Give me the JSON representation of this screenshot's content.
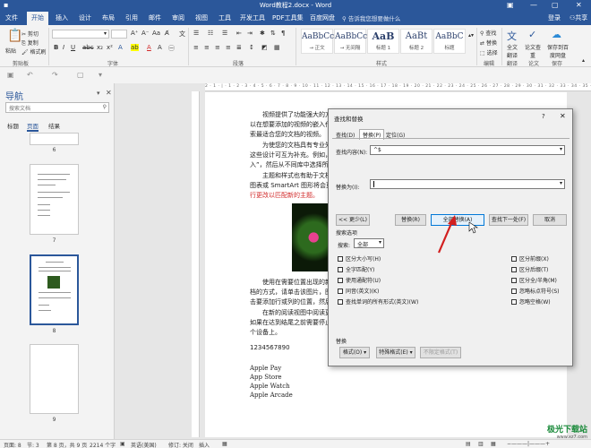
{
  "window": {
    "title": "Word教程2.docx - Word"
  },
  "tabs": [
    "文件",
    "开始",
    "插入",
    "设计",
    "布局",
    "引用",
    "邮件",
    "审阅",
    "视图",
    "工具",
    "开发工具",
    "PDF工具集",
    "百度网盘"
  ],
  "active_tab": "开始",
  "tell_me": "告诉我您想要做什么",
  "account": {
    "login": "登录",
    "share": "共享"
  },
  "ribbon": {
    "clipboard": {
      "paste": "粘贴",
      "cut": "剪切",
      "copy": "复制",
      "format_painter": "格式刷",
      "label": "剪贴板"
    },
    "font": {
      "label": "字体"
    },
    "paragraph": {
      "label": "段落"
    },
    "styles": {
      "label": "样式",
      "items": [
        {
          "preview": "AaBbCc",
          "name": "→ 正文"
        },
        {
          "preview": "AaBbCc",
          "name": "→ 无间隔"
        },
        {
          "preview": "AaB",
          "name": "标题 1"
        },
        {
          "preview": "AaBt",
          "name": "标题 2"
        },
        {
          "preview": "AaBbC",
          "name": "标题"
        }
      ]
    },
    "editing": {
      "find": "查找",
      "replace": "替换",
      "select": "选择",
      "label": "编辑"
    },
    "translate": {
      "full": "全文翻译",
      "label": "翻译"
    },
    "paper": {
      "check": "论文查重",
      "label": "论文"
    },
    "save": {
      "label": "保存到百度网盘",
      "group": "保存"
    }
  },
  "navigation": {
    "title": "导航",
    "search_placeholder": "搜索文档",
    "tabs": [
      "标题",
      "页面",
      "结果"
    ],
    "active_tab": "页面",
    "pages": [
      "6",
      "7",
      "8",
      "9"
    ],
    "selected_page": "8"
  },
  "ruler": "2 · 1 · | · 1 · 2 · 3 · 4 · 5 · 6 · 7 · 8 · 9 · 10 · 11 · 12 · 13 · 14 · 15 · 16 · 17 · 18 · 19 · 20 · 21 · 22 · 23 · 24 · 25 · 26 · 27 · 28 · 29 · 30 · 31 · 32 · 33 · 34 · 35 · 36 · 37",
  "document": {
    "para1": [
      "　　视频提供了功能强大的方",
      "以在想要添加的视频的嵌入代",
      "索最适合您的文档的视频。"
    ],
    "para2": [
      "　　为使您的文档具有专业外",
      "这些设计可互为补充。例如，",
      "入”，然后从不同库中选择所"
    ],
    "para3": [
      "　　主题和样式也有助于文档",
      "图表或 SmartArt 图形将会更"
    ],
    "para3_red": "行更改以匹配新的主题。",
    "para4": [
      "　　使用在需要位置出现的新",
      "档的方式，请单击该图片，图",
      "击要添加行或列的位置，然后"
    ],
    "para5": [
      "　　在新的阅读视图中阅读更",
      "如果在达到结尾之前需要停止",
      "个设备上。"
    ],
    "number": "1234567890",
    "list": [
      "Apple Pay",
      "App Store",
      "Apple Watch",
      "Apple Arcade"
    ]
  },
  "dialog": {
    "title": "查找和替换",
    "help": "?",
    "close": "✕",
    "tabs": [
      "查找(D)",
      "替换(P)",
      "定位(G)"
    ],
    "active_tab": "替换(P)",
    "find_label": "查找内容(N):",
    "find_value": "^$",
    "replace_label": "替换为(I):",
    "replace_value": "",
    "buttons": {
      "less": "<< 更少(L)",
      "replace": "替换(R)",
      "replace_all": "全部替换(A)",
      "find_next": "查找下一处(F)",
      "cancel": "取消"
    },
    "search_options": "搜索选项",
    "search_label": "搜索:",
    "search_value": "全部",
    "options_left": [
      "区分大小写(H)",
      "全字匹配(Y)",
      "使用通配符(U)",
      "同音(英文)(K)",
      "查找单词的所有形式(英文)(W)"
    ],
    "options_right": [
      "区分前缀(X)",
      "区分后缀(T)",
      "区分全/半角(M)",
      "忽略标点符号(S)",
      "忽略空格(W)"
    ],
    "replace_section": "替换",
    "format": "格式(O) ▾",
    "special": "特殊格式(E) ▾",
    "no_format": "不限定格式(T)"
  },
  "status_bar": {
    "page": "页面: 8",
    "section": "节: 3",
    "page_of": "第 8 页，共 9 页",
    "words": "2214 个字",
    "lang": "英语(美国)",
    "track": "修订: 关闭",
    "insert": "插入"
  },
  "watermark": {
    "brand": "极光下载站",
    "url": "www.xz7.com"
  }
}
